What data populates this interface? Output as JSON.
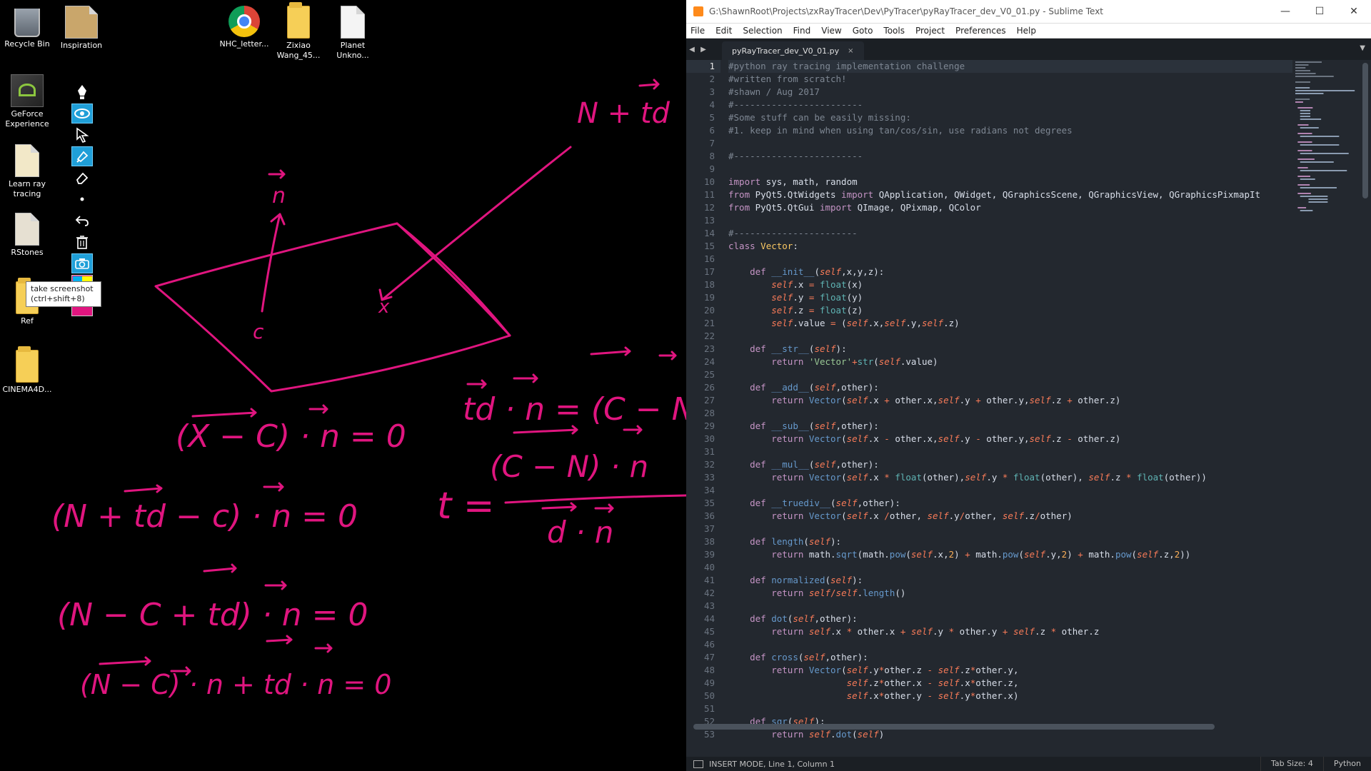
{
  "desktop": {
    "icons": [
      {
        "label": "Recycle Bin",
        "icon": "recycle-bin-icon"
      },
      {
        "label": "Inspiration",
        "icon": "folder-icon"
      },
      {
        "label": "NHC_letter...",
        "icon": "chrome-icon"
      },
      {
        "label": "Zixiao Wang_45...",
        "icon": "folder-icon"
      },
      {
        "label": "Planet Unkno...",
        "icon": "document-icon"
      },
      {
        "label": "GeForce Experience",
        "icon": "geforce-icon"
      },
      {
        "label": "Learn ray tracing",
        "icon": "document-icon"
      },
      {
        "label": "RStones",
        "icon": "document-icon"
      },
      {
        "label": "Ref",
        "icon": "folder-icon"
      },
      {
        "label": "CINEMA4D...",
        "icon": "folder-icon"
      }
    ],
    "tooltip": {
      "line1": "take screenshot",
      "line2": "(ctrl+shift+8)"
    },
    "pen_toolbar": {
      "tools": [
        "pen-icon",
        "eye-icon",
        "cursor-icon",
        "highlighter-icon",
        "eraser-icon",
        "dot-icon",
        "undo-icon",
        "trash-icon",
        "camera-icon"
      ],
      "palette_colors": [
        "#00b0f0",
        "#ffff00",
        "#e0157f",
        "#000000"
      ]
    },
    "drawing": {
      "ink_color": "#e0157f",
      "labels": {
        "n_plus_td": "N + td",
        "normal": "n",
        "center": "c",
        "point": "x",
        "eq1": "(X − C) · n = 0",
        "eq2": "(N + td − c) · n = 0",
        "eq3": "(N − C + td) · n = 0",
        "eq4": "(N − C) · n + td · n = 0",
        "eq5": "td · n = (C − N) · n",
        "t_eq": "t =",
        "numerator": "(C − N) · n",
        "denominator": "d · n"
      }
    }
  },
  "window": {
    "title": "G:\\ShawnRoot\\Projects\\zxRayTracer\\Dev\\PyTracer\\pyRayTracer_dev_V0_01.py - Sublime Text",
    "controls": {
      "minimize": "—",
      "maximize": "☐",
      "close": "✕"
    },
    "menu": [
      "File",
      "Edit",
      "Selection",
      "Find",
      "View",
      "Goto",
      "Tools",
      "Project",
      "Preferences",
      "Help"
    ],
    "tab": {
      "label": "pyRayTracer_dev_V0_01.py",
      "close": "×"
    },
    "nav": {
      "back": "◀",
      "forward": "▶",
      "dropdown": "▼"
    }
  },
  "editor": {
    "current_line": 1,
    "lines": [
      "#python ray tracing implementation challenge",
      "#written from scratch!",
      "#shawn / Aug 2017",
      "#------------------------",
      "#Some stuff can be easily missing:",
      "#1. keep in mind when using tan/cos/sin, use radians not degrees",
      "",
      "#------------------------",
      "",
      "import sys, math, random",
      "from PyQt5.QtWidgets import QApplication, QWidget, QGraphicsScene, QGraphicsView, QGraphicsPixmapIt",
      "from PyQt5.QtGui import QImage, QPixmap, QColor",
      "",
      "#-----------------------",
      "class Vector:",
      "",
      "    def __init__(self,x,y,z):",
      "        self.x = float(x)",
      "        self.y = float(y)",
      "        self.z = float(z)",
      "        self.value = (self.x,self.y,self.z)",
      "",
      "    def __str__(self):",
      "        return 'Vector'+str(self.value)",
      "",
      "    def __add__(self,other):",
      "        return Vector(self.x + other.x,self.y + other.y,self.z + other.z)",
      "",
      "    def __sub__(self,other):",
      "        return Vector(self.x - other.x,self.y - other.y,self.z - other.z)",
      "",
      "    def __mul__(self,other):",
      "        return Vector(self.x * float(other),self.y * float(other), self.z * float(other))",
      "",
      "    def __truediv__(self,other):",
      "        return Vector(self.x /other, self.y/other, self.z/other)",
      "",
      "    def length(self):",
      "        return math.sqrt(math.pow(self.x,2) + math.pow(self.y,2) + math.pow(self.z,2))",
      "",
      "    def normalized(self):",
      "        return self/self.length()",
      "",
      "    def dot(self,other):",
      "        return self.x * other.x + self.y * other.y + self.z * other.z",
      "",
      "    def cross(self,other):",
      "        return Vector(self.y*other.z - self.z*other.y,",
      "                      self.z*other.x - self.x*other.z,",
      "                      self.x*other.y - self.y*other.x)",
      "",
      "    def sqr(self):",
      "        return self.dot(self)"
    ]
  },
  "status": {
    "mode": "INSERT MODE, Line 1, Column 1",
    "tab_size": "Tab Size: 4",
    "syntax": "Python"
  }
}
